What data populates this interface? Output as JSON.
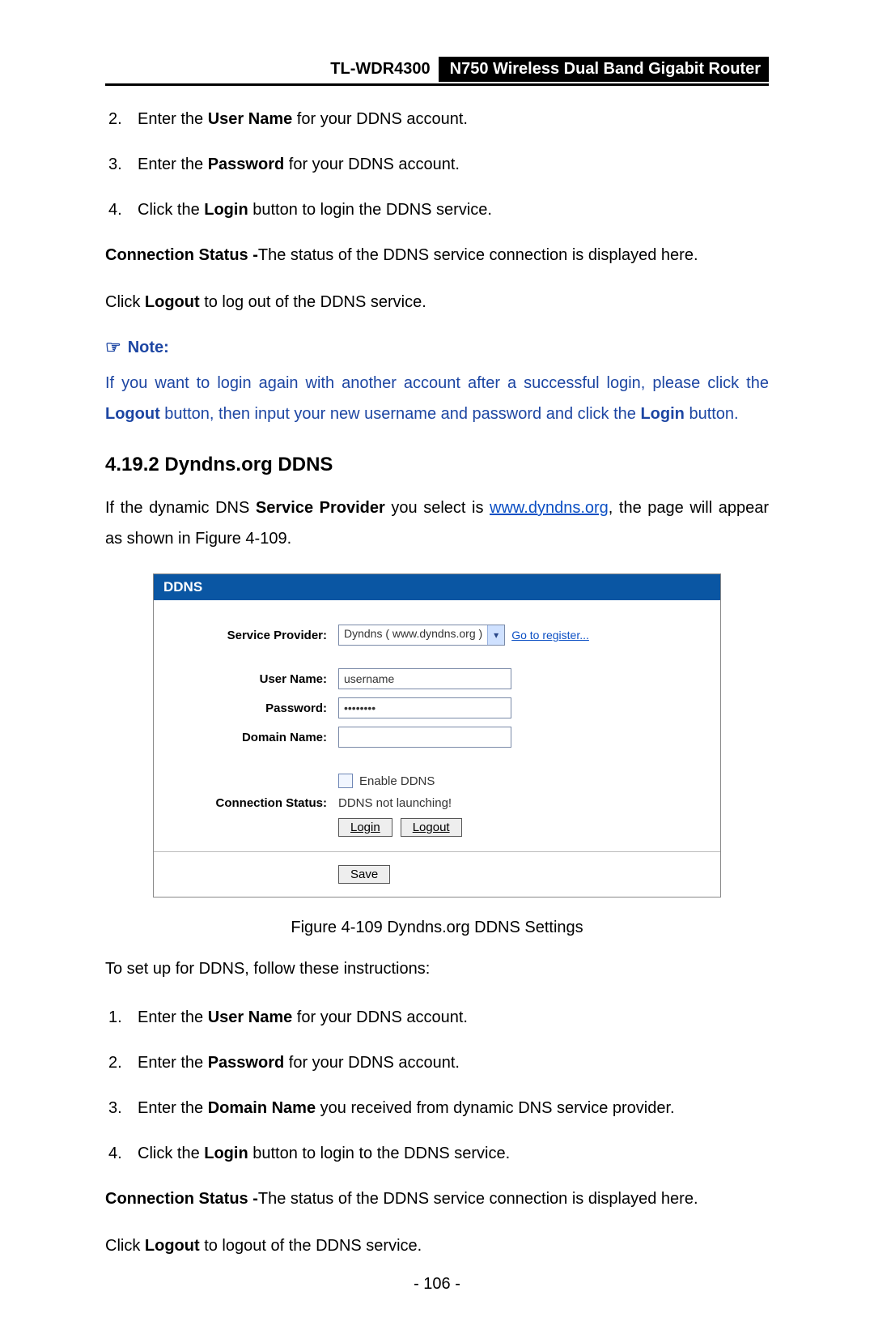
{
  "header": {
    "model": "TL-WDR4300",
    "description": "N750 Wireless Dual Band Gigabit Router"
  },
  "top_list": {
    "items": [
      {
        "num": "2.",
        "pre": "Enter the ",
        "bold": "User Name",
        "post": " for your DDNS account."
      },
      {
        "num": "3.",
        "pre": "Enter the ",
        "bold": "Password",
        "post": " for your DDNS account."
      },
      {
        "num": "4.",
        "pre": "Click the ",
        "bold": "Login",
        "post": " button to login the DDNS service."
      }
    ]
  },
  "conn_para": {
    "bold": "Connection Status -",
    "rest": "The status of the DDNS service connection is displayed here."
  },
  "logout_para": {
    "pre": "Click ",
    "bold": "Logout",
    "post": " to log out of the DDNS service."
  },
  "note": {
    "label": "Note:",
    "text_pre": " If you want to login again with another account after a successful login, please click the ",
    "bold1": "Logout",
    "mid": " button, then input your new username and password and click the ",
    "bold2": "Login",
    "end": " button."
  },
  "section_heading": "4.19.2  Dyndns.org DDNS",
  "intro": {
    "pre": "If the dynamic DNS ",
    "bold": "Service Provider",
    "mid": " you select is ",
    "link": "www.dyndns.org",
    "post": ", the page will appear as shown in Figure 4-109."
  },
  "shot": {
    "title": "DDNS",
    "labels": {
      "service_provider": "Service Provider:",
      "user_name": "User Name:",
      "password": "Password:",
      "domain_name": "Domain Name:",
      "connection_status": "Connection Status:"
    },
    "values": {
      "provider_select": "Dyndns ( www.dyndns.org )",
      "register_link": "Go to register...",
      "username_input": "username",
      "password_input": "••••••••",
      "domain_input": "",
      "enable_ddns": "Enable DDNS",
      "conn_status": "DDNS not launching!"
    },
    "buttons": {
      "login": "Login",
      "logout": "Logout",
      "save": "Save"
    }
  },
  "figure_caption": "Figure 4-109 Dyndns.org DDNS Settings",
  "setup_intro": "To set up for DDNS, follow these instructions:",
  "bottom_list": {
    "items": [
      {
        "num": "1.",
        "pre": "Enter the ",
        "bold": "User Name",
        "post": " for your DDNS account."
      },
      {
        "num": "2.",
        "pre": "Enter the ",
        "bold": "Password",
        "post": " for your DDNS account."
      },
      {
        "num": "3.",
        "pre": "Enter the ",
        "bold": "Domain Name",
        "post": " you received from dynamic DNS service provider."
      },
      {
        "num": "4.",
        "pre": "Click the ",
        "bold": "Login",
        "post": " button to login to the DDNS service."
      }
    ]
  },
  "conn_para2": {
    "bold": "Connection Status -",
    "rest": "The status of the DDNS service connection is displayed here."
  },
  "logout_para2": {
    "pre": "Click ",
    "bold": "Logout",
    "post": " to logout of the DDNS service."
  },
  "page_number": "- 106 -"
}
